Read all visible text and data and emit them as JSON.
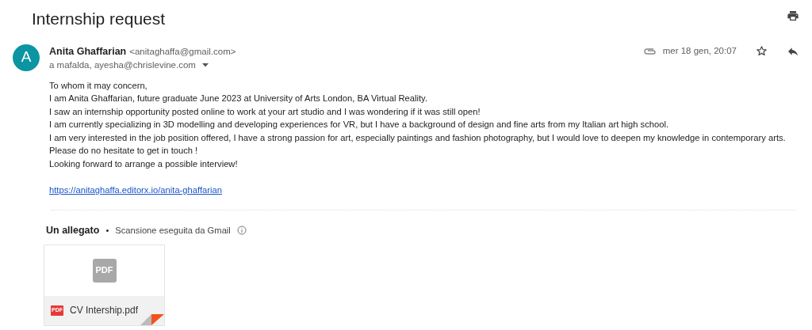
{
  "subject": "Internship request",
  "sender": {
    "initial": "A",
    "name": "Anita Ghaffarian",
    "email": "<anitaghaffa@gmail.com>",
    "recipients": "a mafalda, ayesha@chrislevine.com",
    "date": "mer 18 gen, 20:07",
    "has_attachment": true,
    "starred": false
  },
  "body": [
    "To whom it may concern,",
    "I am Anita Ghaffarian, future graduate June 2023 at University of Arts London,  BA Virtual Reality.",
    "I saw an internship opportunity posted online to work at your art studio and I was wondering if it was still open!",
    "I am currently specializing in 3D modelling and developing experiences for VR, but I have a background of design and fine arts from my Italian art high school.",
    "I am very interested in the job position offered, I have a strong passion for art, especially paintings and fashion photography, but I would love to deepen my knowledge in contemporary arts.",
    "Please do no hesitate to get in touch !",
    "Looking forward to arrange a possible interview!"
  ],
  "link": "https://anitaghaffa.editorx.io/anita-ghaffarian",
  "attachments_header": {
    "count": "Un allegato",
    "separator": "•",
    "scan": "Scansione eseguita da Gmail"
  },
  "attachments": [
    {
      "thumb_label": "PDF",
      "type_label": "PDF",
      "filename": "CV Intership.pdf"
    }
  ]
}
